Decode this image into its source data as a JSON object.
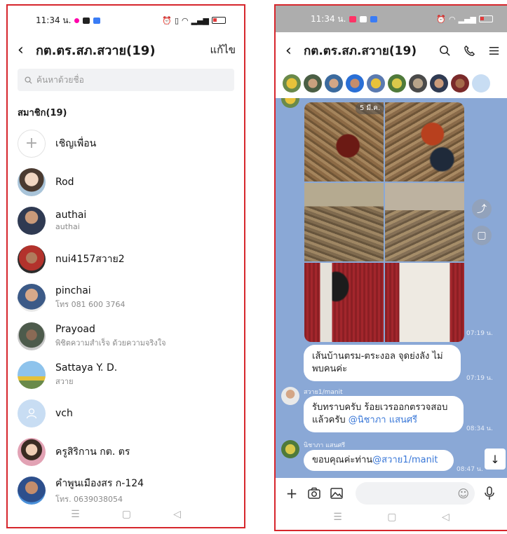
{
  "left": {
    "status": {
      "time": "11:34 น."
    },
    "header": {
      "back_icon": "‹",
      "title": "กต.ตร.สภ.สวาย(19)",
      "edit_label": "แก้ไข"
    },
    "search": {
      "placeholder": "ค้นหาด้วยชื่อ"
    },
    "members_title": "สมาชิก(19)",
    "invite_label": "เชิญเพื่อน",
    "members": [
      {
        "name": "Rod",
        "sub": ""
      },
      {
        "name": "authai",
        "sub": "authai"
      },
      {
        "name": "nui4157สวาย2",
        "sub": ""
      },
      {
        "name": "pinchai",
        "sub": "โทร 081 600 3764"
      },
      {
        "name": "Prayoad",
        "sub": "พิชิตความสำเร็จ ด้วยความจริงใจ"
      },
      {
        "name": "Sattaya Y. D.",
        "sub": "สวาย"
      },
      {
        "name": "vch",
        "sub": ""
      },
      {
        "name": "ครูสิริกาน กต. ตร",
        "sub": ""
      },
      {
        "name": "คำพูนเมืองสร ก-124",
        "sub": "โทร. 0639038054"
      }
    ]
  },
  "right": {
    "status": {
      "time": "11:34 น."
    },
    "header": {
      "back_icon": "‹",
      "title": "กต.ตร.สภ.สวาย(19)"
    },
    "chat": {
      "photo_date": "5 มี.ค.",
      "photo_time": "07:19 น.",
      "msg1": {
        "text": "เส้นบ้านตรม-ตระงอล จุดย่งลัง ไม่พบคนค่ะ",
        "time": "07:19 น."
      },
      "msg2": {
        "sender": "สวาย1/manit",
        "text": "รับทราบครับ ร้อยเวรออกตรวจสอบแล้วครับ ",
        "mention": "@นิชาภา แสนศรี",
        "time": "08:34 น."
      },
      "msg3": {
        "sender": "นิชาภา แสนศรี",
        "text": "ขอบคุณค่ะท่าน",
        "mention": "@สวาย1/manit",
        "time": "08:47 น."
      }
    }
  }
}
